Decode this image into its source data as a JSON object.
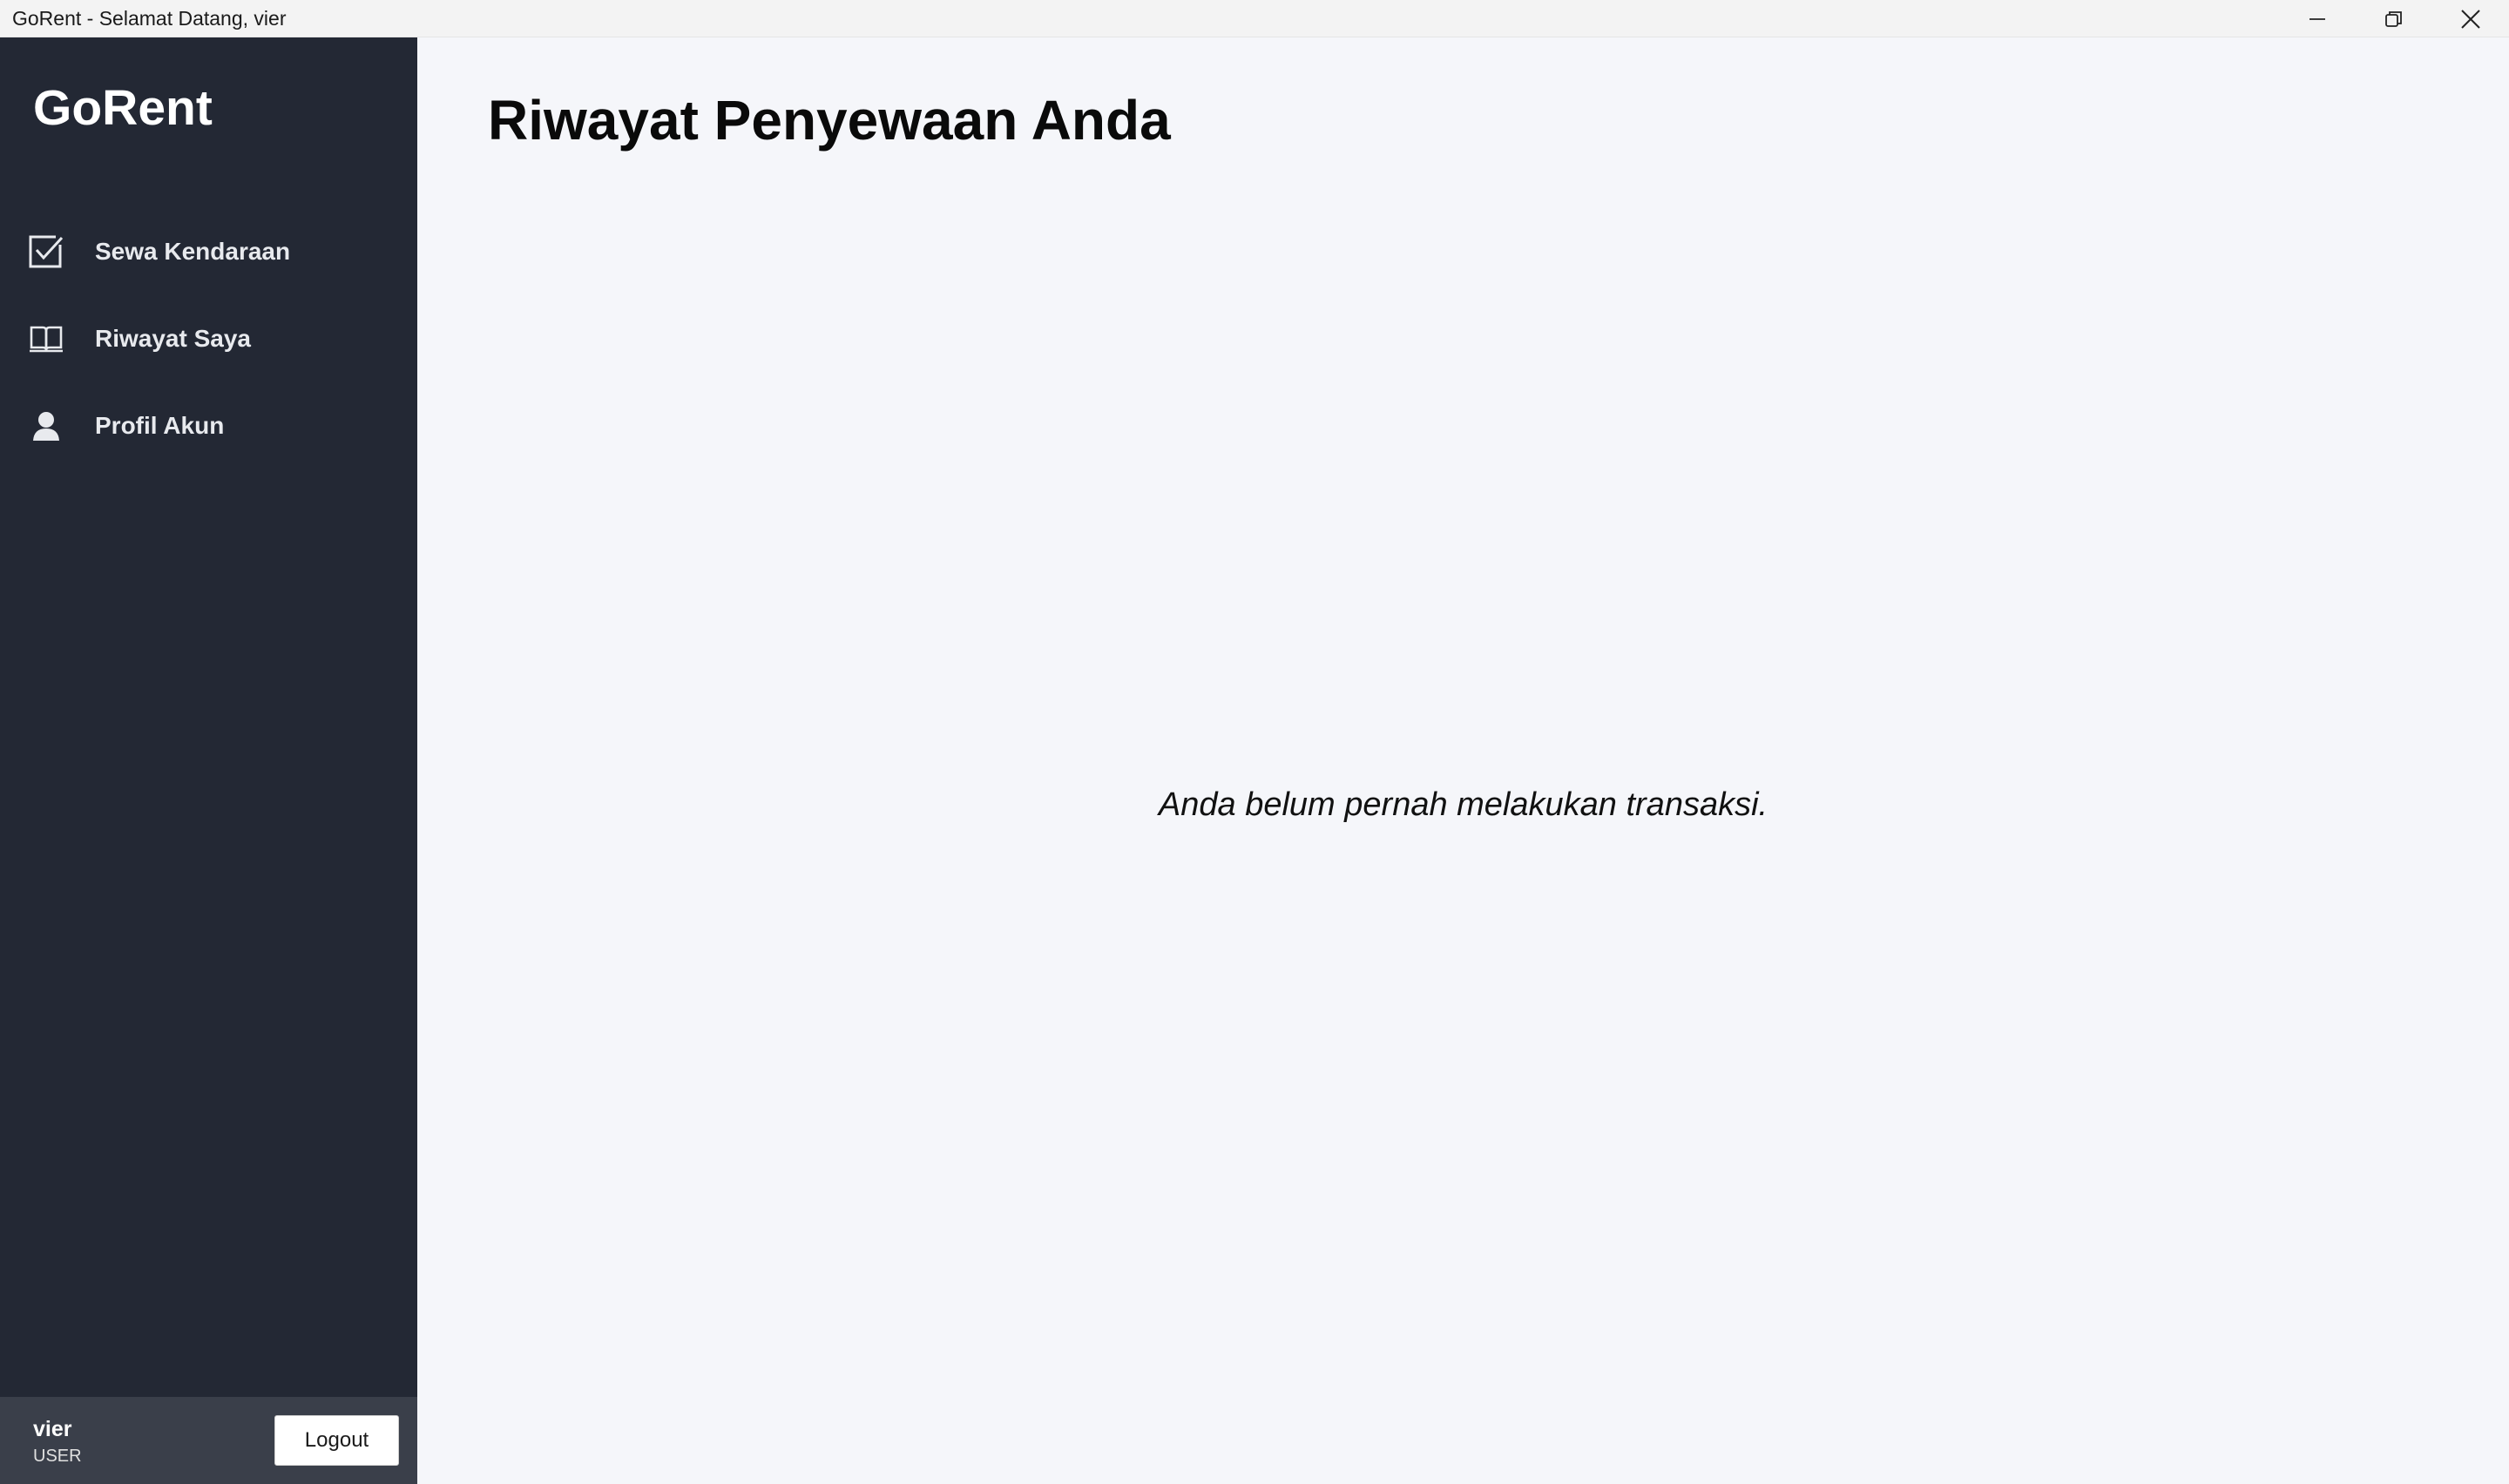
{
  "window": {
    "title": "GoRent - Selamat Datang, vier",
    "controls": [
      "minimize-icon",
      "restore-icon",
      "close-icon"
    ]
  },
  "sidebar": {
    "logo": "GoRent",
    "items": [
      {
        "label": "Sewa Kendaraan",
        "icon": "checkbox-icon"
      },
      {
        "label": "Riwayat Saya",
        "icon": "book-icon"
      },
      {
        "label": "Profil Akun",
        "icon": "user-icon"
      }
    ],
    "user": {
      "name": "vier",
      "role": "USER",
      "logout_label": "Logout"
    }
  },
  "main": {
    "title": "Riwayat Penyewaan Anda",
    "empty_message": "Anda belum pernah melakukan transaksi."
  },
  "colors": {
    "sidebar_bg": "#232834",
    "user_panel_bg": "#3a3f4a",
    "main_bg": "#f5f6fa"
  }
}
